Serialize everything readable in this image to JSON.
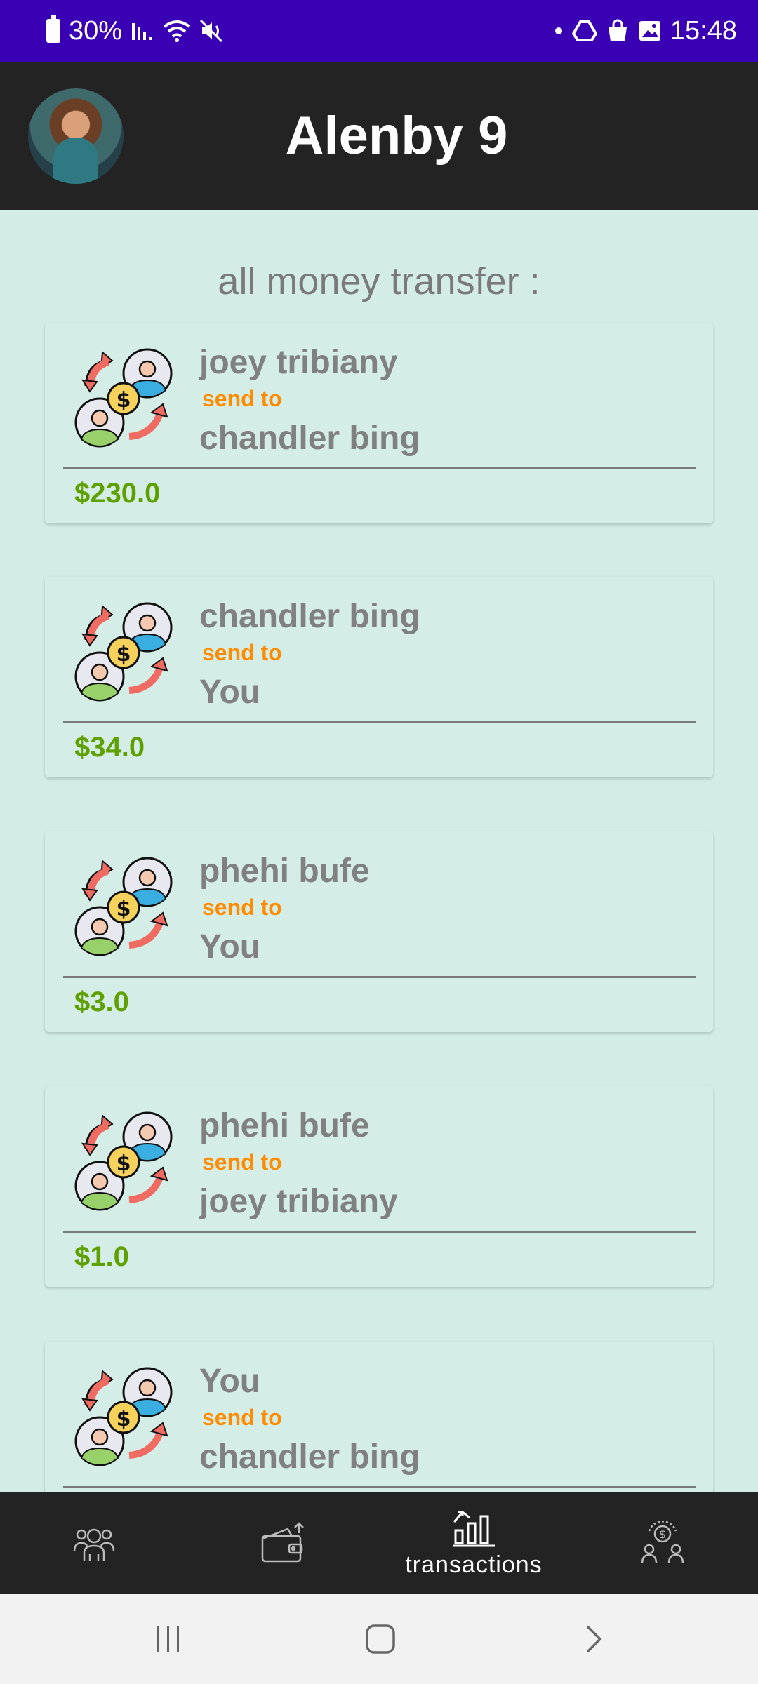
{
  "status_bar": {
    "battery": "30%",
    "time": "15:48"
  },
  "app_bar": {
    "title": "Alenby 9"
  },
  "content": {
    "section_title": "all money transfer :",
    "transactions": [
      {
        "from": "joey tribiany",
        "send_label": "send to",
        "to": "chandler bing",
        "currency": "$",
        "amount": "230.0"
      },
      {
        "from": "chandler bing",
        "send_label": "send to",
        "to": "You",
        "currency": "$",
        "amount": "34.0"
      },
      {
        "from": "phehi bufe",
        "send_label": "send to",
        "to": "You",
        "currency": "$",
        "amount": "3.0"
      },
      {
        "from": "phehi bufe",
        "send_label": "send to",
        "to": "joey tribiany",
        "currency": "$",
        "amount": "1.0"
      },
      {
        "from": "You",
        "send_label": "send to",
        "to": "chandler bing",
        "currency": "$",
        "amount": ""
      }
    ]
  },
  "bottom_nav": {
    "items": [
      {
        "icon": "group-icon",
        "label": ""
      },
      {
        "icon": "wallet-icon",
        "label": ""
      },
      {
        "icon": "bar-chart-icon",
        "label": "transactions",
        "active": true
      },
      {
        "icon": "money-exchange-icon",
        "label": ""
      }
    ]
  },
  "colors": {
    "status_bar": "#3a00b4",
    "app_bar": "#232323",
    "background": "#d3ece5",
    "name_text": "#808080",
    "send_label": "#ff8c00",
    "amount": "#5ea000"
  }
}
